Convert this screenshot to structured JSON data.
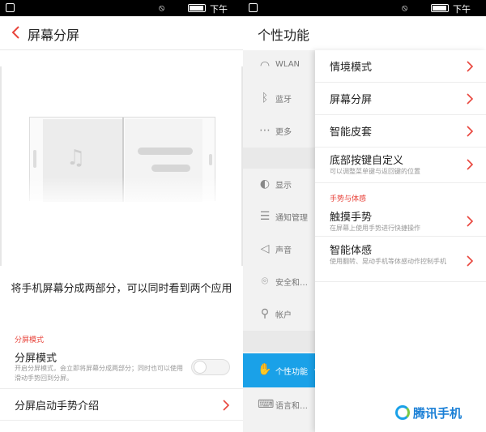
{
  "status_bar": {
    "time": "下午2:22"
  },
  "left_panel": {
    "title": "屏幕分屏",
    "description": "将手机屏幕分成两部分，可以同时看到两个应用",
    "section_label": "分屏模式",
    "split_mode": {
      "title": "分屏模式",
      "subtitle": "开启分屏模式，会立即将屏幕分成两部分；同时也可以使用滑动手势回到分屏。",
      "enabled": false
    },
    "gesture_intro": {
      "title": "分屏启动手势介绍"
    }
  },
  "right_panel": {
    "title": "个性功能",
    "nav": [
      {
        "label": "WLAN",
        "icon": "wifi-icon"
      },
      {
        "label": "蓝牙",
        "icon": "bluetooth-icon"
      },
      {
        "label": "更多",
        "icon": "more-dots-icon"
      },
      {
        "label": "显示",
        "icon": "brightness-icon"
      },
      {
        "label": "通知管理",
        "icon": "notification-list-icon"
      },
      {
        "label": "声音",
        "icon": "speaker-icon"
      },
      {
        "label": "安全和…",
        "icon": "location-pin-icon"
      },
      {
        "label": "帐户",
        "icon": "person-icon"
      },
      {
        "label": "个性功能",
        "icon": "hand-icon",
        "active": true
      },
      {
        "label": "语言和…",
        "icon": "keyboard-icon"
      }
    ],
    "menu": [
      {
        "title": "情境模式"
      },
      {
        "title": "屏幕分屏"
      },
      {
        "title": "智能皮套"
      },
      {
        "title": "底部按键自定义",
        "subtitle": "可以调整菜单键与返回键的位置"
      }
    ],
    "gesture_section_label": "手势与体感",
    "gesture_menu": [
      {
        "title": "触摸手势",
        "subtitle": "在屏幕上使用手势进行快捷操作"
      },
      {
        "title": "智能体感",
        "subtitle": "使用翻转、晃动手机等体感动作控制手机"
      }
    ]
  },
  "watermark": {
    "text": "腾讯手机"
  },
  "colors": {
    "accent_red": "#e8453c",
    "active_blue": "#1aa1e8"
  }
}
